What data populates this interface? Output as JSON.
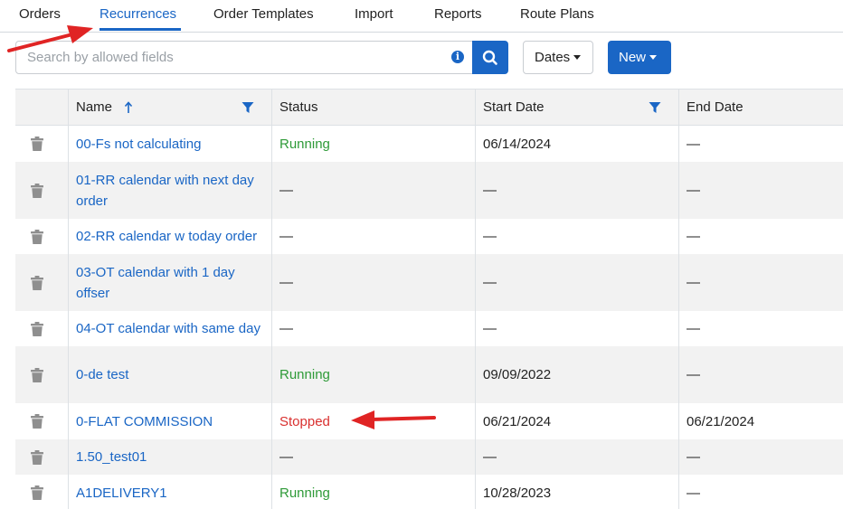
{
  "tabs": {
    "items": [
      {
        "label": "Orders"
      },
      {
        "label": "Recurrences"
      },
      {
        "label": "Order Templates"
      },
      {
        "label": "Import"
      },
      {
        "label": "Reports"
      },
      {
        "label": "Route Plans"
      }
    ],
    "active": "Recurrences"
  },
  "toolbar": {
    "search_placeholder": "Search by allowed fields",
    "search_value": "",
    "dates_label": "Dates",
    "new_label": "New"
  },
  "table": {
    "columns": [
      "",
      "Name",
      "Status",
      "Start Date",
      "End Date"
    ],
    "sorted_column": "Name",
    "filtered_columns": [
      "Name",
      "Start Date"
    ],
    "rows": [
      {
        "name": "00-Fs not calculating",
        "status": "Running",
        "start_date": "06/14/2024",
        "end_date": "—"
      },
      {
        "name": "01-RR calendar with next day order",
        "status": "—",
        "start_date": "—",
        "end_date": "—"
      },
      {
        "name": "02-RR calendar w today order",
        "status": "—",
        "start_date": "—",
        "end_date": "—"
      },
      {
        "name": "03-OT calendar with 1 day offser",
        "status": "—",
        "start_date": "—",
        "end_date": "—"
      },
      {
        "name": "04-OT calendar with same day",
        "status": "—",
        "start_date": "—",
        "end_date": "—"
      },
      {
        "name": "0-de test",
        "status": "Running",
        "start_date": "09/09/2022",
        "end_date": "—"
      },
      {
        "name": "0-FLAT COMMISSION",
        "status": "Stopped",
        "start_date": "06/21/2024",
        "end_date": "06/21/2024"
      },
      {
        "name": "1.50_test01",
        "status": "—",
        "start_date": "—",
        "end_date": "—"
      },
      {
        "name": "A1DELIVERY1",
        "status": "Running",
        "start_date": "10/28/2023",
        "end_date": "—"
      }
    ]
  },
  "colors": {
    "accent": "#1a66c5",
    "running": "#2e9a38",
    "stopped": "#d9302f",
    "annotation_arrow": "#e02424"
  }
}
